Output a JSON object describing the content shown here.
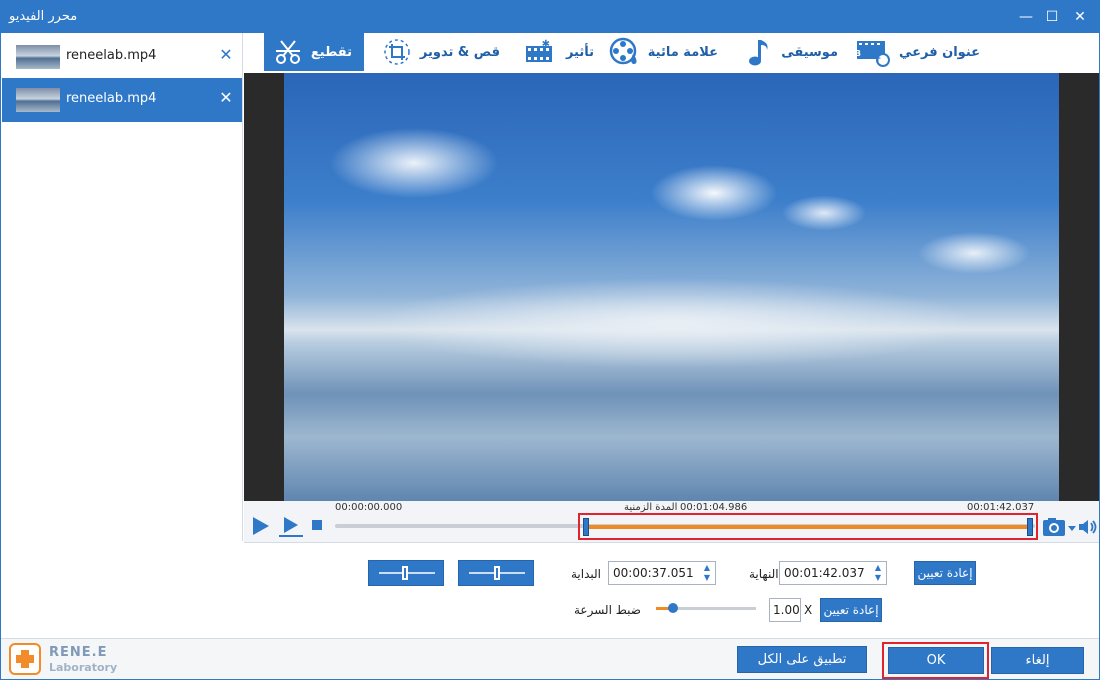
{
  "window": {
    "title": "محرر الفيديو"
  },
  "window_controls": {
    "minimize": "—",
    "maximize": "☐",
    "close": "✕"
  },
  "sidebar": {
    "files": [
      {
        "name": "reneelab.mp4",
        "close": "✕",
        "selected": false
      },
      {
        "name": "reneelab.mp4",
        "close": "✕",
        "selected": true
      }
    ]
  },
  "toolbar": {
    "tabs": [
      {
        "label": "تقطيع",
        "icon": "scissors-icon",
        "active": true
      },
      {
        "label": "قص & تدوير",
        "icon": "crop-rotate-icon",
        "active": false
      },
      {
        "label": "تأثير",
        "icon": "film-effect-icon",
        "active": false
      },
      {
        "label": "علامة مائية",
        "icon": "watermark-icon",
        "active": false
      },
      {
        "label": "موسيقى",
        "icon": "music-note-icon",
        "active": false
      },
      {
        "label": "عنوان فرعي",
        "icon": "subtitle-icon",
        "active": false
      }
    ]
  },
  "timeline": {
    "start_time": "00:00:00.000",
    "duration_label": "المدة الزمنية",
    "duration_value": "00:01:04.986",
    "end_time": "00:01:42.037",
    "selection_start_fraction": 0.365,
    "selection_end_fraction": 1.0
  },
  "controls": {
    "start_label": "البداية",
    "start_value": "00:00:37.051",
    "end_label": "النهاية",
    "end_value": "00:01:42.037",
    "reset_label": "إعادة تعيين",
    "speed_label": "ضبط السرعة",
    "speed_value": "1.00",
    "speed_unit": "X",
    "speed_fraction": 0.17,
    "speed_reset_label": "إعادة تعيين"
  },
  "footer": {
    "logo_brand": "RENE.E",
    "logo_sub": "Laboratory",
    "apply_all_label": "تطبيق على الكل",
    "ok_label": "OK",
    "cancel_label": "إلغاء"
  },
  "colors": {
    "accent": "#2f78c8",
    "selection": "#f08a24",
    "highlight_border": "#e0242f"
  }
}
